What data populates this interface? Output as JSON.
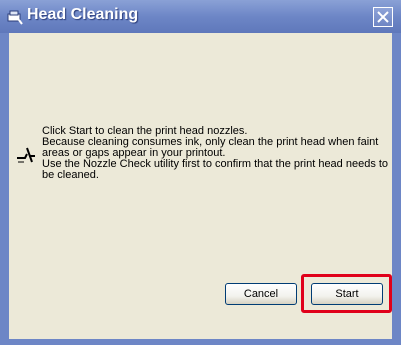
{
  "window": {
    "title": "Head Cleaning",
    "title_icon": "printer-head-icon",
    "close_icon": "close-icon"
  },
  "dialog": {
    "icon": "nozzle-icon",
    "message_lines": [
      "Click Start to clean the print head nozzles.",
      "Because cleaning consumes ink, only clean the print head when faint",
      "areas or gaps appear in your printout.",
      "Use the Nozzle Check utility first to confirm that the print head needs to",
      "be cleaned."
    ]
  },
  "buttons": {
    "cancel_label": "Cancel",
    "start_label": "Start"
  },
  "colors": {
    "titlebar": "#6d86c6",
    "client_bg": "#ece9d8",
    "highlight": "#e0001a"
  }
}
